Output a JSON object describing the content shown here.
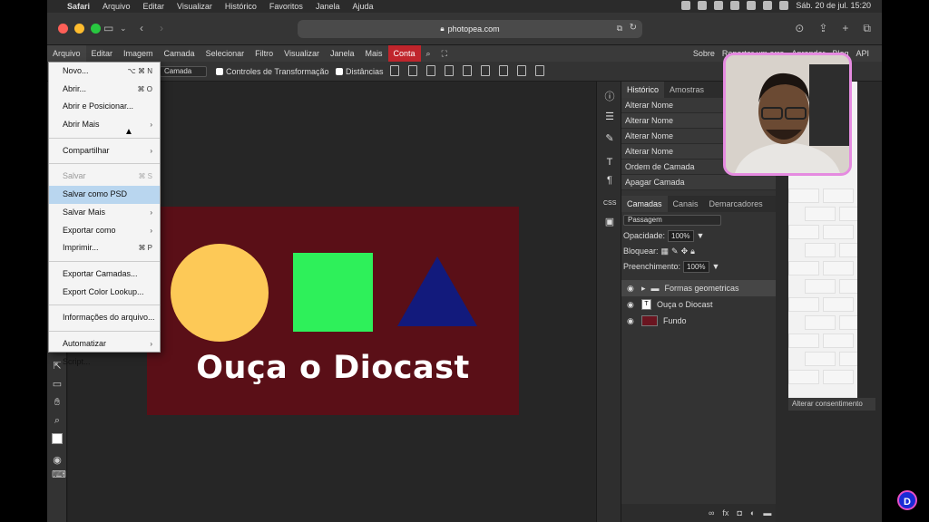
{
  "mac_menubar": {
    "app": "Safari",
    "items": [
      "Arquivo",
      "Editar",
      "Visualizar",
      "Histórico",
      "Favoritos",
      "Janela",
      "Ajuda"
    ],
    "datetime": "Sáb. 20 de jul.  15:20"
  },
  "safari": {
    "url": "photopea.com"
  },
  "menu": {
    "items": [
      "Arquivo",
      "Editar",
      "Imagem",
      "Camada",
      "Selecionar",
      "Filtro",
      "Visualizar",
      "Janela",
      "Mais",
      "Conta"
    ],
    "right_items": [
      "Sobre",
      "Reportar um erro",
      "Aprender",
      "Blog",
      "API"
    ]
  },
  "options": {
    "layer_select": "Camada",
    "transform_controls": "Controles de Transformação",
    "distances": "Distâncias"
  },
  "dropdown": [
    {
      "label": "Novo...",
      "shortcut": "⌥ ⌘ N",
      "sep_after": false
    },
    {
      "label": "Abrir...",
      "shortcut": "⌘ O",
      "sep_after": false
    },
    {
      "label": "Abrir e Posicionar...",
      "shortcut": "",
      "sep_after": false
    },
    {
      "label": "Abrir Mais",
      "shortcut": "›",
      "sep_after": true
    },
    {
      "label": "Compartilhar",
      "shortcut": "›",
      "sep_after": true
    },
    {
      "label": "Salvar",
      "shortcut": "⌘ S",
      "sep_after": false,
      "disabled": true
    },
    {
      "label": "Salvar como PSD",
      "shortcut": "",
      "sep_after": false,
      "highlighted": true
    },
    {
      "label": "Salvar Mais",
      "shortcut": "›",
      "sep_after": false
    },
    {
      "label": "Exportar como",
      "shortcut": "›",
      "sep_after": false
    },
    {
      "label": "Imprimir...",
      "shortcut": "⌘ P",
      "sep_after": true
    },
    {
      "label": "Exportar Camadas...",
      "shortcut": "",
      "sep_after": false
    },
    {
      "label": "Export Color Lookup...",
      "shortcut": "",
      "sep_after": true
    },
    {
      "label": "Informações do arquivo...",
      "shortcut": "",
      "sep_after": true
    },
    {
      "label": "Automatizar",
      "shortcut": "›",
      "sep_after": false
    },
    {
      "label": "Script...",
      "shortcut": "",
      "sep_after": false
    }
  ],
  "artwork": {
    "text": "Ouça o Diocast",
    "background": "#5a0f17",
    "circle_color": "#fdc957",
    "square_color": "#2ef05a",
    "triangle_color": "#121a7c"
  },
  "history": {
    "tabs": [
      "Histórico",
      "Amostras"
    ],
    "rows": [
      "Alterar Nome",
      "Alterar Nome",
      "Alterar Nome",
      "Alterar Nome",
      "Ordem de Camada",
      "Apagar Camada"
    ]
  },
  "layers": {
    "tabs": [
      "Camadas",
      "Canais",
      "Demarcadores"
    ],
    "blend_mode": "Passagem",
    "opacity_label": "Opacidade:",
    "opacity_value": "100%",
    "lock_label": "Bloquear:",
    "fill_label": "Preenchimento:",
    "fill_value": "100%",
    "rows": [
      {
        "name": "Formas geometricas",
        "kind": "folder"
      },
      {
        "name": "Ouça o Diocast",
        "kind": "text"
      },
      {
        "name": "Fundo",
        "kind": "image"
      }
    ]
  },
  "consent": "Alterar consentimento"
}
